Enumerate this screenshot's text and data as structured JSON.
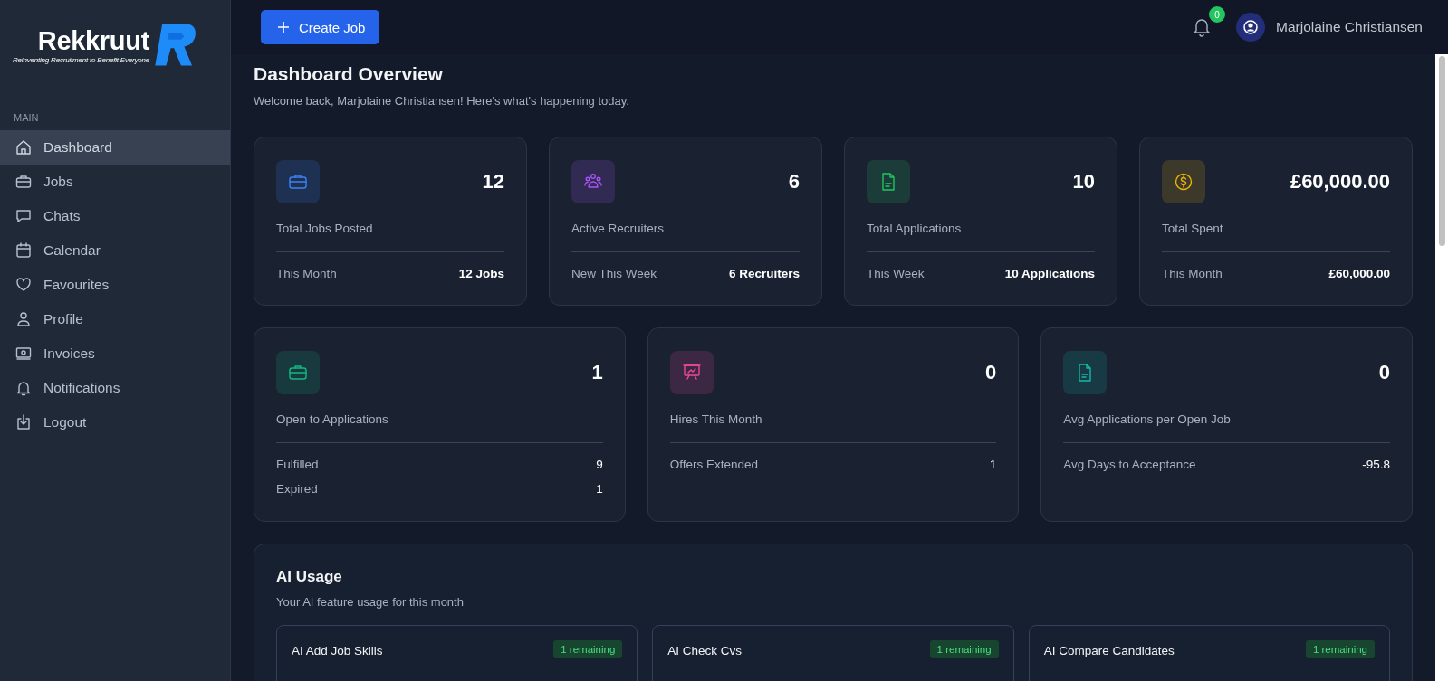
{
  "sidebar": {
    "brand": "Rekkruut",
    "tagline": "Reinventing Recruitment to Benefit Everyone",
    "section": "MAIN",
    "items": [
      {
        "label": "Dashboard",
        "selected": true
      },
      {
        "label": "Jobs",
        "selected": false
      },
      {
        "label": "Chats",
        "selected": false
      },
      {
        "label": "Calendar",
        "selected": false
      },
      {
        "label": "Favourites",
        "selected": false
      },
      {
        "label": "Profile",
        "selected": false
      },
      {
        "label": "Invoices",
        "selected": false
      },
      {
        "label": "Notifications",
        "selected": false
      },
      {
        "label": "Logout",
        "selected": false
      }
    ]
  },
  "header": {
    "create_button": "Create Job",
    "notification_count": "0",
    "user_name": "Marjolaine Christiansen"
  },
  "page": {
    "title": "Dashboard Overview",
    "subtitle": "Welcome back, Marjolaine Christiansen! Here's what's happening today."
  },
  "stat_cards": [
    {
      "value": "12",
      "label": "Total Jobs Posted",
      "color": "#3b82f6",
      "rows": [
        {
          "label": "This Month",
          "value": "12 Jobs"
        }
      ]
    },
    {
      "value": "6",
      "label": "Active Recruiters",
      "color": "#a855f7",
      "rows": [
        {
          "label": "New This Week",
          "value": "6 Recruiters"
        }
      ]
    },
    {
      "value": "10",
      "label": "Total Applications",
      "color": "#22c55e",
      "rows": [
        {
          "label": "This Week",
          "value": "10 Applications"
        }
      ]
    },
    {
      "value": "£60,000.00",
      "label": "Total Spent",
      "color": "#eab308",
      "rows": [
        {
          "label": "This Month",
          "value": "£60,000.00"
        }
      ]
    }
  ],
  "metric_cards": [
    {
      "value": "1",
      "label": "Open to Applications",
      "color": "#10b981",
      "rows": [
        {
          "label": "Fulfilled",
          "value": "9"
        },
        {
          "label": "Expired",
          "value": "1"
        }
      ]
    },
    {
      "value": "0",
      "label": "Hires This Month",
      "color": "#ec4899",
      "rows": [
        {
          "label": "Offers Extended",
          "value": "1"
        }
      ]
    },
    {
      "value": "0",
      "label": "Avg Applications per Open Job",
      "color": "#14b8a6",
      "rows": [
        {
          "label": "Avg Days to Acceptance",
          "value": "-95.8"
        }
      ]
    }
  ],
  "ai_usage": {
    "title": "AI Usage",
    "subtitle": "Your AI feature usage for this month",
    "features": [
      {
        "name": "AI Add Job Skills",
        "badge": "1 remaining"
      },
      {
        "name": "AI Check Cvs",
        "badge": "1 remaining"
      },
      {
        "name": "AI Compare Candidates",
        "badge": "1 remaining"
      }
    ]
  }
}
